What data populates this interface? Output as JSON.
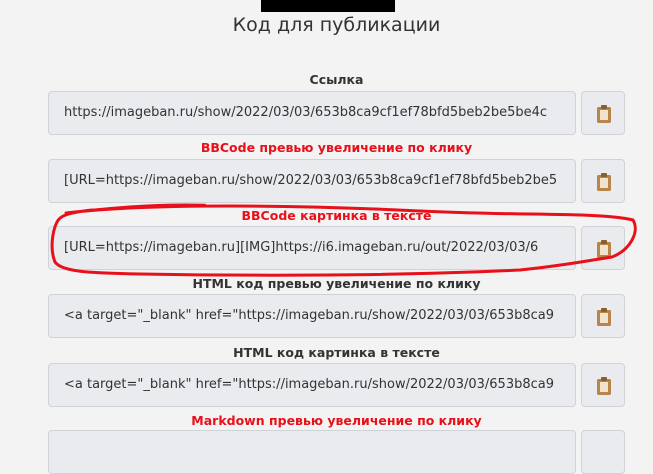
{
  "page": {
    "title": "Код для публикации"
  },
  "links": [
    {
      "label": "Ссылка",
      "label_red": false,
      "value": "https://imageban.ru/show/2022/03/03/653b8ca9cf1ef78bfd5beb2be5be4c"
    },
    {
      "label": "BBCode превью увеличение по клику",
      "label_red": true,
      "value": "[URL=https://imageban.ru/show/2022/03/03/653b8ca9cf1ef78bfd5beb2be5"
    },
    {
      "label": "BBCode картинка в тексте",
      "label_red": true,
      "value": "[URL=https://imageban.ru][IMG]https://i6.imageban.ru/out/2022/03/03/6"
    },
    {
      "label": "HTML код превью увеличение по клику",
      "label_red": false,
      "value": "<a target=\"_blank\" href=\"https://imageban.ru/show/2022/03/03/653b8ca9"
    },
    {
      "label": "HTML код картинка в тексте",
      "label_red": false,
      "value": "<a target=\"_blank\" href=\"https://imageban.ru/show/2022/03/03/653b8ca9"
    },
    {
      "label": "Markdown превью увеличение по клику",
      "label_red": true,
      "value": ""
    }
  ],
  "icons": {
    "copy": "clipboard-icon"
  },
  "colors": {
    "label_red": "#e8101a",
    "clipboard": "#b8864b",
    "annotation": "#e8101a"
  }
}
